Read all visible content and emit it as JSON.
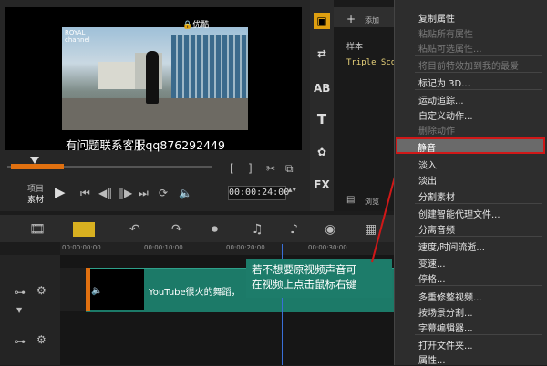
{
  "preview": {
    "video_logo": "ROYAL\nchannel",
    "watermark": "🔒优酷",
    "caption": "有问题联系客服qq876292449",
    "mode_project": "项目",
    "mode_clip": "素材",
    "timecode": "00:00:24:00"
  },
  "library": {
    "add_label": "添加",
    "sample_label": "样本",
    "item": "Triple Sco",
    "browse_label": "浏览",
    "tool_labels": [
      "AB",
      "T",
      "FX"
    ]
  },
  "timeline": {
    "ruler_ticks": [
      "00:00:00:00",
      "00:00:10:00",
      "00:00:20:00",
      "00:00:30:00"
    ],
    "clip_text": "YouTube很火的舞蹈，"
  },
  "context_menu": {
    "items": [
      {
        "label": "复制属性",
        "enabled": true
      },
      {
        "label": "粘贴所有属性",
        "enabled": false
      },
      {
        "label": "粘贴可选属性...",
        "enabled": false
      },
      {
        "label": "将目前特效加到我的最爱",
        "enabled": false
      },
      {
        "label": "标记为 3D...",
        "enabled": true
      },
      {
        "label": "运动追踪...",
        "enabled": true
      },
      {
        "label": "自定义动作...",
        "enabled": true
      },
      {
        "label": "删除动作",
        "enabled": false
      },
      {
        "label": "静音",
        "enabled": true,
        "highlighted": true
      },
      {
        "label": "淡入",
        "enabled": true
      },
      {
        "label": "淡出",
        "enabled": true
      },
      {
        "label": "分割素材",
        "enabled": true
      },
      {
        "label": "创建智能代理文件...",
        "enabled": true
      },
      {
        "label": "分离音频",
        "enabled": true
      },
      {
        "label": "速度/时间流逝...",
        "enabled": true
      },
      {
        "label": "变速...",
        "enabled": true
      },
      {
        "label": "停格...",
        "enabled": true
      },
      {
        "label": "多重修整视频...",
        "enabled": true
      },
      {
        "label": "按场景分割...",
        "enabled": true
      },
      {
        "label": "字幕编辑器...",
        "enabled": true
      },
      {
        "label": "打开文件夹...",
        "enabled": true
      },
      {
        "label": "属性...",
        "enabled": true
      }
    ]
  },
  "annotation": {
    "line1": "若不想要原视频声音可",
    "line2": "在视频上点击鼠标右键"
  },
  "colors": {
    "highlight_border": "#d01818",
    "clip_green": "#1c7a68",
    "trim_orange": "#e07010"
  }
}
